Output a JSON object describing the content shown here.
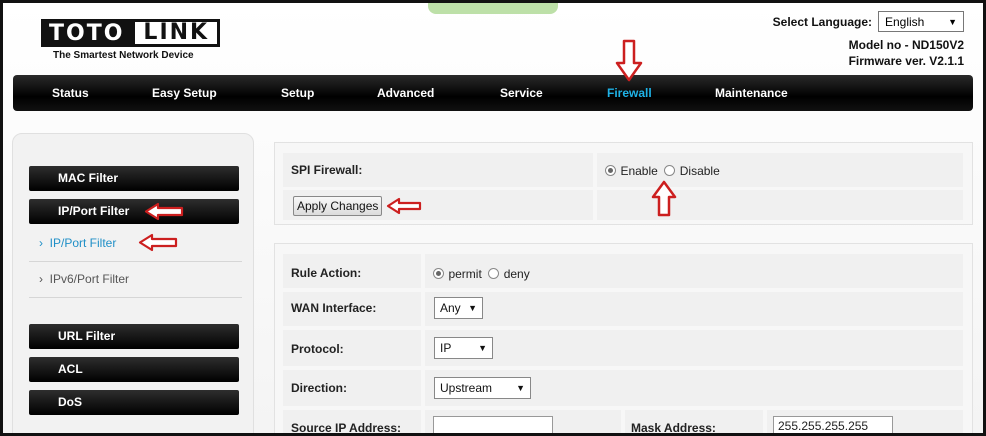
{
  "header": {
    "logo_left": "TOTO",
    "logo_right": "LINK",
    "tagline": "The Smartest Network Device",
    "language_label": "Select Language:",
    "language_value": "English",
    "model": "Model no - ND150V2",
    "firmware": "Firmware ver. V2.1.1"
  },
  "nav": {
    "items": [
      {
        "label": "Status"
      },
      {
        "label": "Easy Setup"
      },
      {
        "label": "Setup"
      },
      {
        "label": "Advanced"
      },
      {
        "label": "Service"
      },
      {
        "label": "Firewall",
        "active": true
      },
      {
        "label": "Maintenance"
      }
    ],
    "active_color": "#1fb2e6"
  },
  "sidebar": {
    "buttons": [
      "MAC Filter",
      "IP/Port Filter",
      "URL Filter",
      "ACL",
      "DoS"
    ],
    "subitems": [
      {
        "label": "IP/Port Filter",
        "active": true
      },
      {
        "label": "IPv6/Port Filter",
        "active": false
      }
    ]
  },
  "spi": {
    "label": "SPI Firewall:",
    "enable": "Enable",
    "disable": "Disable",
    "selected": "Enable",
    "apply": "Apply Changes"
  },
  "filter_form": {
    "rule_action_label": "Rule Action:",
    "permit": "permit",
    "deny": "deny",
    "rule_action_selected": "permit",
    "wan_label": "WAN Interface:",
    "wan_value": "Any",
    "protocol_label": "Protocol:",
    "protocol_value": "IP",
    "direction_label": "Direction:",
    "direction_value": "Upstream",
    "source_ip_label": "Source IP Address:",
    "source_ip_value": "",
    "mask_label": "Mask Address:",
    "mask_value": "255.255.255.255"
  },
  "icons": {
    "dropdown": "▼",
    "bullet": "›",
    "annotation_arrow_color": "#cc1f1f"
  }
}
